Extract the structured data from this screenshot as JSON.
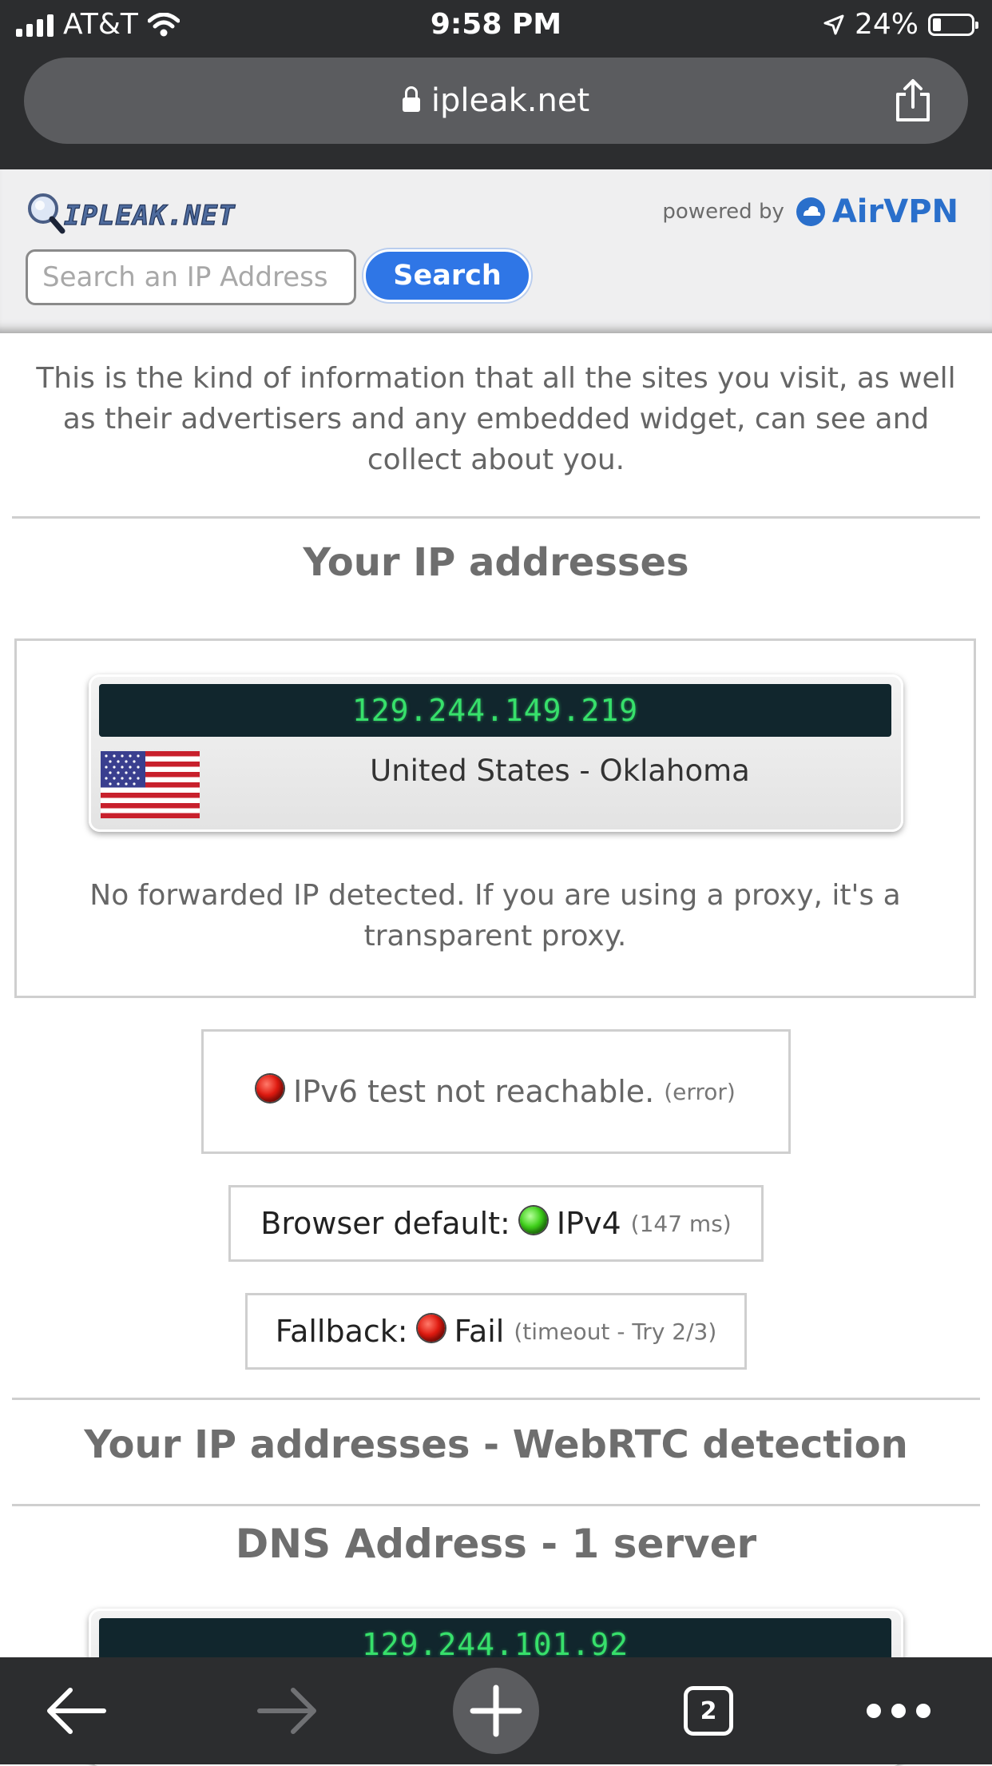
{
  "status_bar": {
    "carrier": "AT&T",
    "time": "9:58 PM",
    "battery": "24%",
    "battery_level": 0.24,
    "icons": [
      "signal-icon",
      "wifi-icon",
      "location-arrow-icon",
      "battery-icon"
    ]
  },
  "browser": {
    "url": "ipleak.net",
    "tab_count": "2",
    "icons": [
      "lock-icon",
      "share-icon",
      "back-arrow-icon",
      "forward-arrow-icon",
      "new-tab-plus-icon",
      "tabs-icon",
      "more-icon"
    ]
  },
  "header": {
    "logo_text": "IPLEAK.NET",
    "powered_by": "powered by",
    "brand": "AirVPN",
    "search_placeholder": "Search an IP Address",
    "search_button": "Search"
  },
  "intro": "This is the kind of information that all the sites you visit, as well as their advertisers and any embedded widget, can see and collect about you.",
  "ip_section": {
    "title": "Your IP addresses",
    "ip": "129.244.149.219",
    "location": "United States - Oklahoma",
    "forwarded_note": "No forwarded IP detected. If you are using a proxy, it's a transparent proxy."
  },
  "ipv6_status": {
    "text": "IPv6 test not reachable.",
    "detail": "(error)",
    "color": "red"
  },
  "browser_default": {
    "label": "Browser default:",
    "value": "IPv4",
    "detail": "(147 ms)",
    "color": "green"
  },
  "fallback": {
    "label": "Fallback:",
    "value": "Fail",
    "detail": "(timeout - Try 2/3)",
    "color": "red"
  },
  "webrtc_section": {
    "title": "Your IP addresses - WebRTC detection"
  },
  "dns_section": {
    "title": "DNS Address - 1 server",
    "ip": "129.244.101.92"
  },
  "colors": {
    "chrome_bg": "#2c2d2f",
    "accent_blue": "#2f76e6",
    "ip_display_bg": "#11262d",
    "ip_text_green": "#37e06b"
  }
}
